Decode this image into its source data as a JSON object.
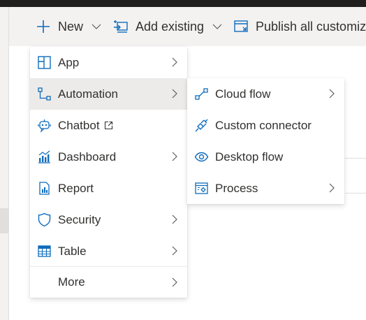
{
  "toolbar": {
    "new_label": "New",
    "add_existing_label": "Add existing",
    "publish_label": "Publish all customiza"
  },
  "menu": {
    "items": [
      {
        "label": "App",
        "icon": "app-icon",
        "submenu": true
      },
      {
        "label": "Automation",
        "icon": "automation-icon",
        "submenu": true,
        "selected": true
      },
      {
        "label": "Chatbot",
        "icon": "chatbot-icon",
        "submenu": false,
        "external": true
      },
      {
        "label": "Dashboard",
        "icon": "dashboard-icon",
        "submenu": true
      },
      {
        "label": "Report",
        "icon": "report-icon",
        "submenu": false
      },
      {
        "label": "Security",
        "icon": "shield-icon",
        "submenu": true
      },
      {
        "label": "Table",
        "icon": "table-icon",
        "submenu": true
      },
      {
        "label": "More",
        "icon": "",
        "submenu": true
      }
    ]
  },
  "submenu": {
    "items": [
      {
        "label": "Cloud flow",
        "icon": "cloud-flow-icon",
        "submenu": true
      },
      {
        "label": "Custom connector",
        "icon": "connector-icon",
        "submenu": false
      },
      {
        "label": "Desktop flow",
        "icon": "eye-icon",
        "submenu": false
      },
      {
        "label": "Process",
        "icon": "process-icon",
        "submenu": true
      }
    ]
  },
  "colors": {
    "accent": "#0f6cbd",
    "selected_bg": "#edebe9",
    "text": "#323130"
  }
}
